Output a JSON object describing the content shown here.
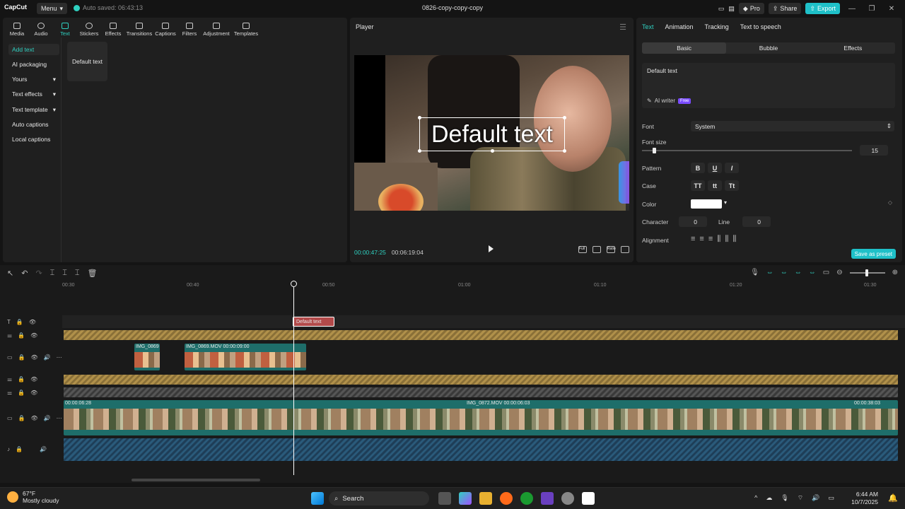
{
  "app": {
    "logo": "CapCut",
    "menu": "Menu",
    "autosave": "Auto saved: 06:43:13",
    "project_title": "0826-copy-copy-copy"
  },
  "titlebar_right": {
    "pro": "Pro",
    "share": "Share",
    "export": "Export"
  },
  "tools": [
    {
      "label": "Media",
      "icon": "media-icon"
    },
    {
      "label": "Audio",
      "icon": "audio-icon"
    },
    {
      "label": "Text",
      "icon": "text-icon",
      "active": true
    },
    {
      "label": "Stickers",
      "icon": "stickers-icon"
    },
    {
      "label": "Effects",
      "icon": "effects-icon"
    },
    {
      "label": "Transitions",
      "icon": "transitions-icon"
    },
    {
      "label": "Captions",
      "icon": "captions-icon"
    },
    {
      "label": "Filters",
      "icon": "filters-icon"
    },
    {
      "label": "Adjustment",
      "icon": "adjustment-icon"
    },
    {
      "label": "Templates",
      "icon": "templates-icon"
    }
  ],
  "sidebar": [
    {
      "label": "Add text",
      "active": true
    },
    {
      "label": "AI packaging"
    },
    {
      "label": "Yours",
      "dropdown": true
    },
    {
      "label": "Text effects",
      "dropdown": true
    },
    {
      "label": "Text template",
      "dropdown": true
    },
    {
      "label": "Auto captions"
    },
    {
      "label": "Local captions"
    }
  ],
  "text_card": "Default text",
  "player": {
    "title": "Player",
    "overlay_text": "Default text",
    "current_time": "00:00:47:25",
    "total_time": "00:06:19:04",
    "ctrl_full": "Full",
    "ctrl_ratio": "Ratio"
  },
  "props": {
    "tabs": [
      "Text",
      "Animation",
      "Tracking",
      "Text to speech"
    ],
    "segments": [
      "Basic",
      "Bubble",
      "Effects"
    ],
    "text_value": "Default text",
    "ai_writer": "AI writer",
    "free_badge": "Free",
    "font_label": "Font",
    "font_value": "System",
    "size_label": "Font size",
    "size_value": "15",
    "size_fraction": 0.05,
    "pattern_label": "Pattern",
    "pattern_btns": [
      "B",
      "U",
      "I"
    ],
    "case_label": "Case",
    "case_btns": [
      "TT",
      "tt",
      "Tt"
    ],
    "color_label": "Color",
    "color_value": "#ffffff",
    "character_label": "Character",
    "character_value": "0",
    "line_label": "Line",
    "line_value": "0",
    "alignment_label": "Alignment",
    "save_preset": "Save as preset"
  },
  "timeline": {
    "ruler": [
      "00:30",
      "00:40",
      "00:50",
      "01:00",
      "01:10",
      "01:20",
      "01:30"
    ],
    "text_clip": "Default text",
    "clip_a": "IMG_0869",
    "clip_b": "IMG_0869.MOV  00:00:09:00",
    "main_clip_start": "00:00:06:28",
    "main_clip_mid": "IMG_0872.MOV  00:00:06:03",
    "main_clip_end": "00:00:38:03"
  },
  "taskbar": {
    "temp": "67°F",
    "condition": "Mostly cloudy",
    "search": "Search",
    "time": "6:44 AM",
    "date": "10/7/2025"
  },
  "colors": {
    "accent": "#2fd0c0",
    "export": "#1fc0c8",
    "text_clip": "#b34a4a"
  }
}
